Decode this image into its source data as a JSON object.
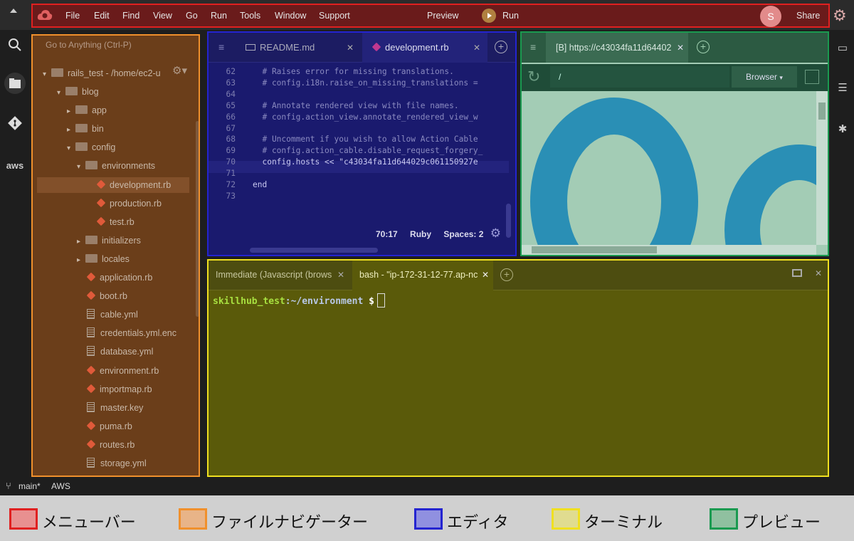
{
  "menubar": {
    "items": [
      "File",
      "Edit",
      "Find",
      "View",
      "Go",
      "Run",
      "Tools",
      "Window",
      "Support"
    ],
    "preview_label": "Preview",
    "run_label": "Run",
    "avatar_initial": "S",
    "share_label": "Share"
  },
  "file_tree": {
    "goto_placeholder": "Go to Anything (Ctrl-P)",
    "root_label": "rails_test - /home/ec2-u",
    "items": [
      {
        "label": "blog",
        "kind": "folder",
        "open": true
      },
      {
        "label": "app",
        "kind": "folder",
        "open": false
      },
      {
        "label": "bin",
        "kind": "folder",
        "open": false
      },
      {
        "label": "config",
        "kind": "folder",
        "open": true
      },
      {
        "label": "environments",
        "kind": "folder",
        "open": true
      },
      {
        "label": "development.rb",
        "kind": "ruby",
        "selected": true
      },
      {
        "label": "production.rb",
        "kind": "ruby"
      },
      {
        "label": "test.rb",
        "kind": "ruby"
      },
      {
        "label": "initializers",
        "kind": "folder",
        "open": false
      },
      {
        "label": "locales",
        "kind": "folder",
        "open": false
      },
      {
        "label": "application.rb",
        "kind": "ruby"
      },
      {
        "label": "boot.rb",
        "kind": "ruby"
      },
      {
        "label": "cable.yml",
        "kind": "file"
      },
      {
        "label": "credentials.yml.enc",
        "kind": "file"
      },
      {
        "label": "database.yml",
        "kind": "file"
      },
      {
        "label": "environment.rb",
        "kind": "ruby"
      },
      {
        "label": "importmap.rb",
        "kind": "ruby"
      },
      {
        "label": "master.key",
        "kind": "file"
      },
      {
        "label": "puma.rb",
        "kind": "ruby"
      },
      {
        "label": "routes.rb",
        "kind": "ruby"
      },
      {
        "label": "storage.yml",
        "kind": "file"
      }
    ]
  },
  "editor": {
    "tabs": [
      {
        "label": "README.md",
        "active": false
      },
      {
        "label": "development.rb",
        "active": true
      }
    ],
    "lines": [
      {
        "n": "62",
        "text": "  # Raises error for missing translations."
      },
      {
        "n": "63",
        "text": "  # config.i18n.raise_on_missing_translations = "
      },
      {
        "n": "64",
        "text": ""
      },
      {
        "n": "65",
        "text": "  # Annotate rendered view with file names."
      },
      {
        "n": "66",
        "text": "  # config.action_view.annotate_rendered_view_w"
      },
      {
        "n": "67",
        "text": ""
      },
      {
        "n": "68",
        "text": "  # Uncomment if you wish to allow Action Cable"
      },
      {
        "n": "69",
        "text": "  # config.action_cable.disable_request_forgery_"
      },
      {
        "n": "70",
        "text": "  config.hosts << \"c43034fa11d644029c061150927e"
      },
      {
        "n": "71",
        "text": ""
      },
      {
        "n": "72",
        "text": "end"
      },
      {
        "n": "73",
        "text": ""
      }
    ],
    "status": {
      "position": "70:17",
      "language": "Ruby",
      "spaces": "Spaces: 2"
    }
  },
  "preview": {
    "tab_label": "[B] https://c43034fa11d64402",
    "url": "/",
    "browser_label": "Browser"
  },
  "terminal": {
    "tabs": [
      {
        "label": "Immediate (Javascript (brows",
        "active": false
      },
      {
        "label": "bash - \"ip-172-31-12-77.ap-nc",
        "active": true
      }
    ],
    "prompt_user": "skillhub_test",
    "prompt_path": ":~/environment",
    "prompt_symbol": "$"
  },
  "statusbar": {
    "branch": "main*",
    "aws": "AWS"
  },
  "left_rail": {
    "aws_label": "aws"
  },
  "legend": [
    {
      "label": "メニューバー",
      "color": "#e02020",
      "fill": "#e89090"
    },
    {
      "label": "ファイルナビゲーター",
      "color": "#f0902c",
      "fill": "#e8b488"
    },
    {
      "label": "エディタ",
      "color": "#2424d0",
      "fill": "#9090e0"
    },
    {
      "label": "ターミナル",
      "color": "#f0e020",
      "fill": "#e0dc90"
    },
    {
      "label": "プレビュー",
      "color": "#1a9a50",
      "fill": "#90c0a0"
    }
  ]
}
